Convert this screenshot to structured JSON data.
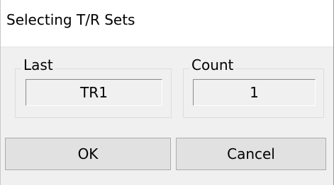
{
  "window": {
    "title": "Selecting T/R Sets"
  },
  "groups": {
    "last": {
      "label": "Last",
      "value": "TR1"
    },
    "count": {
      "label": "Count",
      "value": "1"
    }
  },
  "buttons": {
    "ok_label": "OK",
    "cancel_label": "Cancel"
  },
  "colors": {
    "client_background": "#f0f0f0",
    "button_face": "#e1e1e1",
    "button_border": "#adadad"
  }
}
